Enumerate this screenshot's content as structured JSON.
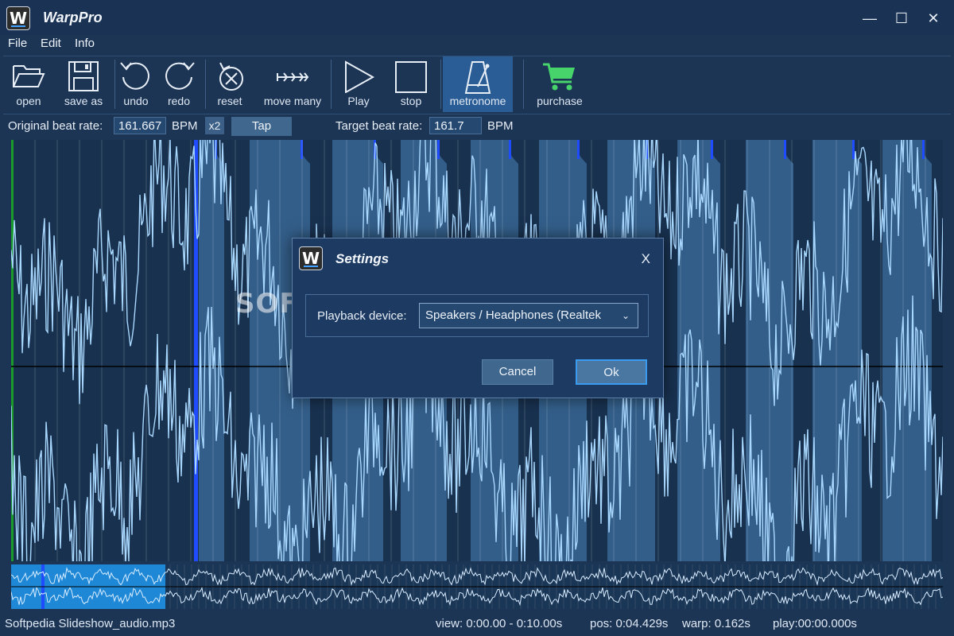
{
  "window": {
    "logo_letter": "W",
    "title": "WarpPro",
    "minimize": "—",
    "maximize": "☐",
    "close": "✕"
  },
  "menu": [
    "File",
    "Edit",
    "Info"
  ],
  "toolbar": {
    "open": "open",
    "save_as": "save as",
    "undo": "undo",
    "redo": "redo",
    "reset": "reset",
    "move_many": "move many",
    "play": "Play",
    "stop": "stop",
    "metronome": "metronome",
    "purchase": "purchase"
  },
  "beat": {
    "original_label": "Original beat rate:",
    "original_value": "161.667",
    "bpm1": "BPM",
    "x2": "x2",
    "tap": "Tap",
    "target_label": "Target beat rate:",
    "target_value": "161.7",
    "bpm2": "BPM"
  },
  "colors": {
    "background": "#1c3555",
    "waveform": "#a9d8ff",
    "beat_marker": "#1f4cff",
    "start_marker": "#1a9a2a",
    "active_button": "#2a5d95",
    "cart_icon": "#46d46b"
  },
  "watermark": "SOFTPEDIA",
  "settings_dialog": {
    "logo_letter": "W",
    "title": "Settings",
    "close": "X",
    "playback_label": "Playback device:",
    "playback_value": "Speakers / Headphones (Realtek",
    "cancel": "Cancel",
    "ok": "Ok"
  },
  "status": {
    "file": "Softpedia Slideshow_audio.mp3",
    "view": "view: 0:00.00 - 0:10.00s",
    "pos": "pos: 0:04.429s",
    "warp": "warp: 0.162s",
    "play": "play:00:00.000s"
  }
}
